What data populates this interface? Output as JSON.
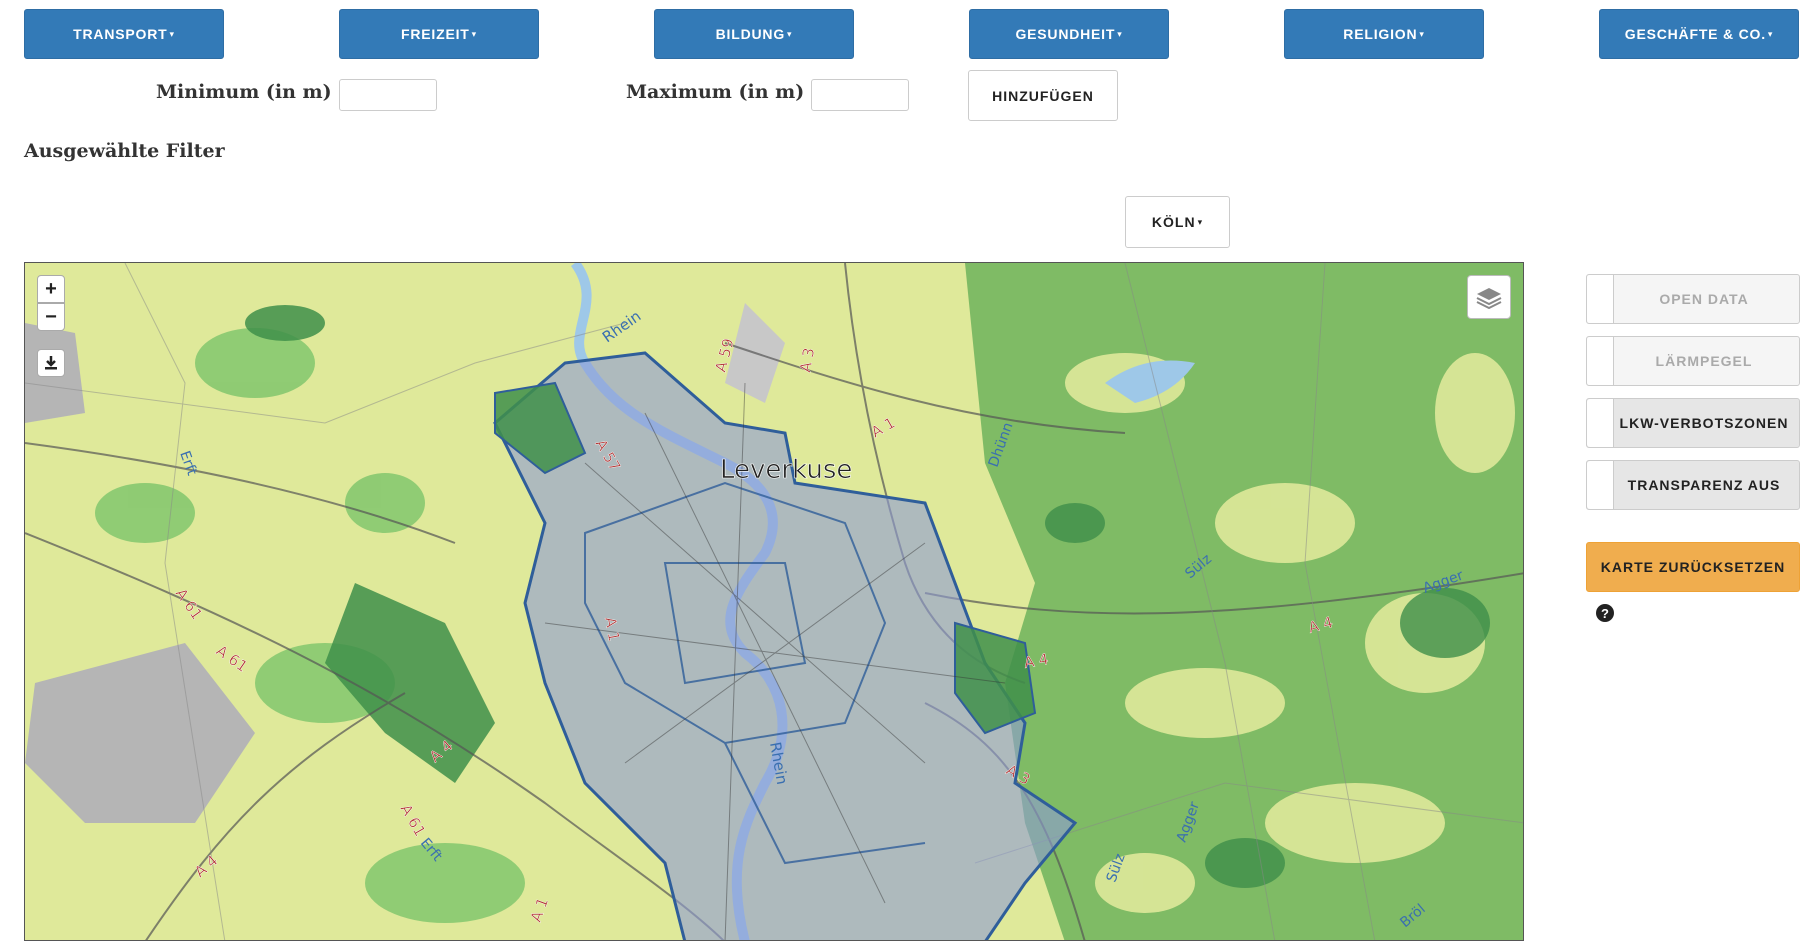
{
  "categories": [
    {
      "label": "TRANSPORT"
    },
    {
      "label": "FREIZEIT"
    },
    {
      "label": "BILDUNG"
    },
    {
      "label": "GESUNDHEIT"
    },
    {
      "label": "RELIGION"
    },
    {
      "label": "GESCHÄFTE & CO."
    }
  ],
  "caret": "▾",
  "distance": {
    "min_label": "Minimum (in m)",
    "min_value": "",
    "max_label": "Maximum (in m)",
    "max_value": "",
    "add_label": "HINZUFÜGEN"
  },
  "filters": {
    "title": "Ausgewählte Filter"
  },
  "city_select": {
    "label": "KÖLN"
  },
  "map": {
    "zoom_in": "+",
    "zoom_out": "−",
    "download_icon": "download-icon",
    "layers_icon": "layers-icon",
    "labels": {
      "city": "Leverkuse",
      "rhein": "Rhein",
      "dhuenn": "Dhünn",
      "sulz": "Sülz",
      "agger": "Agger",
      "erft": "Erft",
      "broel": "Bröl",
      "a1": "A 1",
      "a3": "A 3",
      "a4": "A 4",
      "a57": "A 57",
      "a59": "A 59",
      "a61": "A 61"
    },
    "colors": {
      "land": "#dfe99a",
      "forest": "#6fb35c",
      "urban_overlay": "#8e9bd6",
      "boundary": "#2f5e9a",
      "water": "#9ec8e8",
      "industrial": "#b5b5b5"
    }
  },
  "side": {
    "open_data": "OPEN DATA",
    "laermpegel": "LÄRMPEGEL",
    "lkw": "LKW-VERBOTSZONEN",
    "transparenz": "TRANSPARENZ AUS",
    "reset": "KARTE ZURÜCKSETZEN",
    "reset_color": "#f0ad4e",
    "help_icon": "question-circle-icon"
  }
}
